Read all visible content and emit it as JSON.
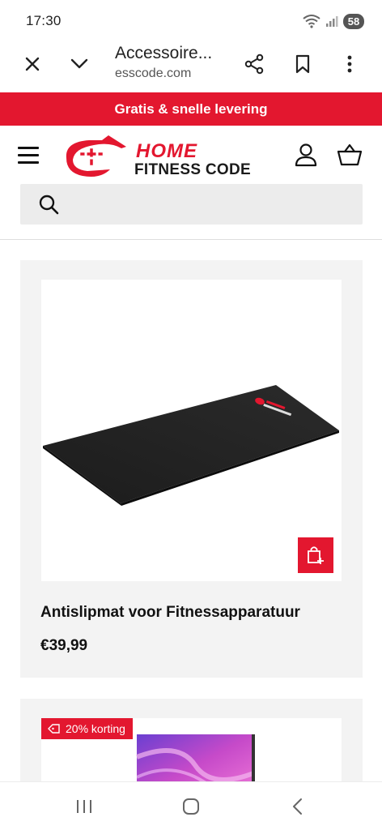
{
  "status_bar": {
    "time": "17:30",
    "battery": "58"
  },
  "browser": {
    "page_title": "Accessoire...",
    "domain": "esscode.com"
  },
  "promo": {
    "text": "Gratis & snelle levering"
  },
  "logo": {
    "line1": "HOME",
    "line2": "FITNESS CODE"
  },
  "search": {
    "placeholder": ""
  },
  "products": [
    {
      "title": "Antislipmat voor Fitnessapparatuur",
      "price": "€39,99"
    },
    {
      "badge": "20% korting"
    }
  ],
  "colors": {
    "brand_red": "#e3172f",
    "card_bg": "#f3f3f3"
  },
  "icons": [
    "close-icon",
    "chevron-down-icon",
    "share-icon",
    "bookmark-icon",
    "more-icon",
    "menu-icon",
    "user-icon",
    "basket-icon",
    "search-icon",
    "add-to-cart-icon",
    "tag-icon",
    "recent-apps-icon",
    "home-icon",
    "back-icon"
  ]
}
